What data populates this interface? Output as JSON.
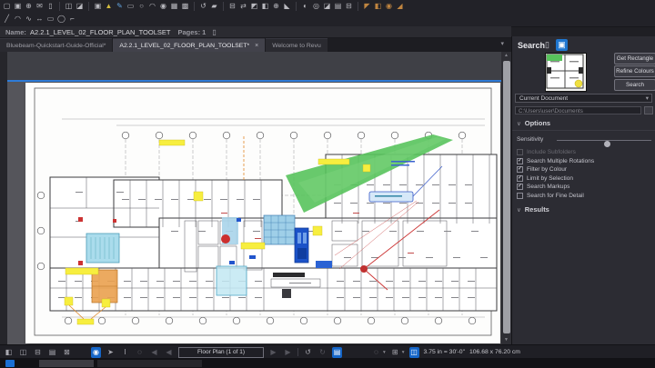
{
  "toolbar": {
    "row1": [
      {
        "n": "open",
        "g": "▢"
      },
      {
        "n": "save",
        "g": "▣"
      },
      {
        "n": "print",
        "g": "⊕"
      },
      {
        "n": "email",
        "g": "✉"
      },
      {
        "n": "page-setup",
        "g": "▯"
      },
      "|",
      {
        "n": "copy-page",
        "g": "◫"
      },
      {
        "n": "paste-page",
        "g": "◪"
      },
      "|",
      {
        "n": "stamp",
        "g": "▣"
      },
      {
        "n": "highlighter",
        "g": "▲",
        "c": "#d4bc3e"
      },
      {
        "n": "pen",
        "g": "✎",
        "c": "#62a4de"
      },
      {
        "n": "text-box",
        "g": "▭"
      },
      {
        "n": "ellipse",
        "g": "○"
      },
      {
        "n": "cloud",
        "g": "◠"
      },
      {
        "n": "callout",
        "g": "◉"
      },
      {
        "n": "image",
        "g": "▦"
      },
      {
        "n": "crop",
        "g": "▩"
      },
      "|",
      {
        "n": "rotate-view",
        "g": "↺"
      },
      {
        "n": "panels",
        "g": "▰"
      },
      "|",
      {
        "n": "flatten",
        "g": "⊟"
      },
      {
        "n": "compare",
        "g": "⇄"
      },
      {
        "n": "overlay",
        "g": "◩"
      },
      {
        "n": "split-doc",
        "g": "◧"
      },
      {
        "n": "combine",
        "g": "⊕"
      },
      {
        "n": "snapshot",
        "g": "◣"
      },
      "|",
      {
        "n": "sync",
        "g": "◐"
      },
      {
        "n": "tracker",
        "g": "◎"
      },
      {
        "n": "flag",
        "g": "◪"
      },
      {
        "n": "layers",
        "g": "▤"
      },
      {
        "n": "bookmarks",
        "g": "⊟"
      },
      "|",
      {
        "n": "measure-length",
        "g": "◤",
        "c": "#c08540"
      },
      {
        "n": "measure-area",
        "g": "◧",
        "c": "#c08540"
      },
      {
        "n": "measure-volume",
        "g": "◉",
        "c": "#c08540"
      },
      {
        "n": "measure-angle",
        "g": "◢",
        "c": "#c08540"
      }
    ],
    "row2": [
      {
        "n": "line",
        "g": "╱"
      },
      {
        "n": "arc",
        "g": "◠"
      },
      {
        "n": "polyline",
        "g": "∿"
      },
      {
        "n": "dimension",
        "g": "↔"
      },
      {
        "n": "rectangle",
        "g": "▭"
      },
      {
        "n": "ellipse-tool",
        "g": "◯"
      },
      {
        "n": "polygon",
        "g": "⌐"
      }
    ]
  },
  "name_bar": {
    "name_label": "Name:",
    "name_value": "A2.2.1_LEVEL_02_FLOOR_PLAN_TOOLSET",
    "pages_label": "Pages: 1",
    "page_icon": "▯"
  },
  "tabs": [
    {
      "label": "Bluebeam-Quickstart-Guide-Official*",
      "active": false
    },
    {
      "label": "A2.2.1_LEVEL_02_FLOOR_PLAN_TOOLSET*",
      "active": true,
      "closable": true
    },
    {
      "label": "Welcome to Revu",
      "active": false
    }
  ],
  "search_panel": {
    "title": "Search",
    "icons": {
      "text_search": "▯",
      "visual_search": "▣"
    },
    "buttons": {
      "get_rectangle": "Get Rectangle",
      "refine_colours": "Refine Colours",
      "search": "Search"
    },
    "scope_value": "Current Document",
    "path_value": "C:\\Users\\user\\Documents",
    "options_label": "Options",
    "sensitivity_label": "Sensitivity",
    "checkboxes": [
      {
        "label": "Include Subfolders",
        "checked": false,
        "enabled": false
      },
      {
        "label": "Search Multiple Rotations",
        "checked": true,
        "enabled": true
      },
      {
        "label": "Filter by Colour",
        "checked": true,
        "enabled": true
      },
      {
        "label": "Limit by Selection",
        "checked": true,
        "enabled": true
      },
      {
        "label": "Search Markups",
        "checked": true,
        "enabled": true
      },
      {
        "label": "Search for Fine Detail",
        "checked": false,
        "enabled": true
      }
    ],
    "results_label": "Results"
  },
  "status_bar": {
    "left_icons": [
      {
        "n": "thumbnails-panel",
        "g": "◧"
      },
      {
        "n": "split-vertical",
        "g": "◫"
      },
      {
        "n": "split-horizontal",
        "g": "⊟"
      },
      {
        "n": "sync-views",
        "g": "▤"
      },
      {
        "n": "detach-window",
        "g": "⊠"
      }
    ],
    "nav_icons": [
      {
        "n": "pan",
        "g": "◉",
        "active": true
      },
      {
        "n": "select",
        "g": "➤"
      },
      {
        "n": "select-text",
        "g": "I"
      },
      {
        "n": "zoom",
        "g": "◌"
      },
      {
        "n": "first-page",
        "g": "◀",
        "disabled": true
      },
      {
        "n": "previous-page",
        "g": "◀",
        "disabled": true
      },
      {
        "type": "pagebox"
      },
      {
        "n": "next-page",
        "g": "▶",
        "disabled": true
      },
      {
        "n": "last-page",
        "g": "▶",
        "disabled": true
      },
      {
        "type": "sep"
      },
      {
        "n": "previous-view",
        "g": "↺"
      },
      {
        "n": "next-view",
        "g": "↻",
        "disabled": true
      },
      {
        "n": "fit-document",
        "g": "▤",
        "active": true
      }
    ],
    "page_label": "Floor Plan (1 of 1)",
    "zoom_icon": "◌",
    "scale_mode_icon": "⊞",
    "fit_page_icon": "◫",
    "scale": "3.75 in = 30'-0\"",
    "dimensions": "106.68 x 76.20 cm"
  },
  "colors": {
    "accent_blue": "#1f76cf",
    "highlight_green": "#58c35c",
    "markup_yellow": "#f7ee3f",
    "markup_cyan": "#aadcec",
    "elevator_blue": "#1b52c8",
    "markup_orange": "#eaa14f",
    "markup_red": "#cc3333"
  }
}
